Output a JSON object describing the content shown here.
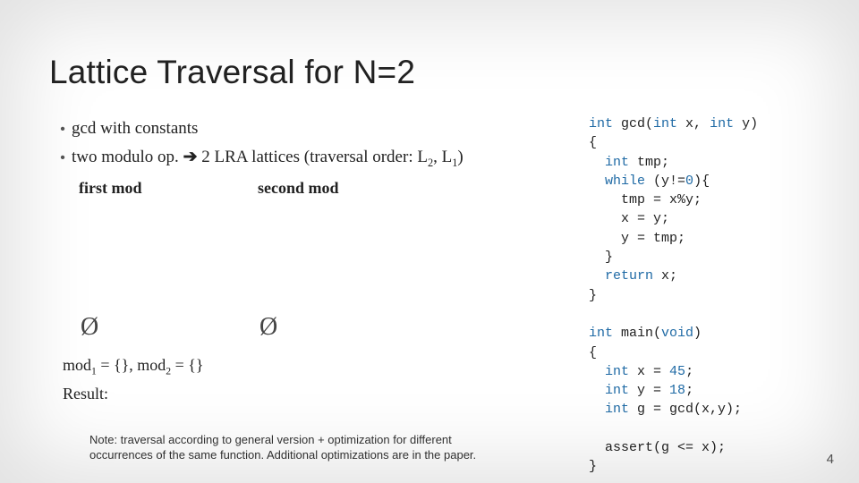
{
  "title": "Lattice Traversal for N=2",
  "bullets": {
    "b1": "gcd with constants",
    "b2_pre": "two modulo op. ",
    "b2_arrow": "➔",
    "b2_post_a": " 2 LRA lattices (traversal order: L",
    "b2_sub1": "2",
    "b2_mid": ", L",
    "b2_sub2": "1",
    "b2_close": ")"
  },
  "heads": {
    "first": "first mod",
    "second": "second mod"
  },
  "emptyset": "Ø",
  "modline": {
    "pre": "mod",
    "s1": "1",
    "mid": " = {}, mod",
    "s2": "2",
    "post": " = {}"
  },
  "result_label": "Result:",
  "note": "Note: traversal according to general version + optimization for different occurrences of the same function. Additional optimizations are in the paper.",
  "code": {
    "kw_int": "int",
    "gcd_sig_a": " gcd(",
    "gcd_sig_b": " x, ",
    "gcd_sig_c": " y)",
    "lbrace": "{",
    "tmp_decl": " tmp;",
    "kw_while": "while",
    "while_cond": " (y!=",
    "zero": "0",
    "while_close": "){",
    "l_tmp": "    tmp = x%y;",
    "l_x": "    x = y;",
    "l_y": "    y = tmp;",
    "rbrace_inner": "  }",
    "kw_return": "return",
    "ret_tail": " x;",
    "rbrace": "}",
    "main_sig_a": " main(",
    "kw_void": "void",
    "main_sig_b": ")",
    "mx_a": " x = ",
    "mx_v": "45",
    "semi": ";",
    "my_a": " y = ",
    "my_v": "18",
    "mg_a": " g = gcd(x,y);",
    "assert": "  assert(g <= x);"
  },
  "pagenum": "4"
}
